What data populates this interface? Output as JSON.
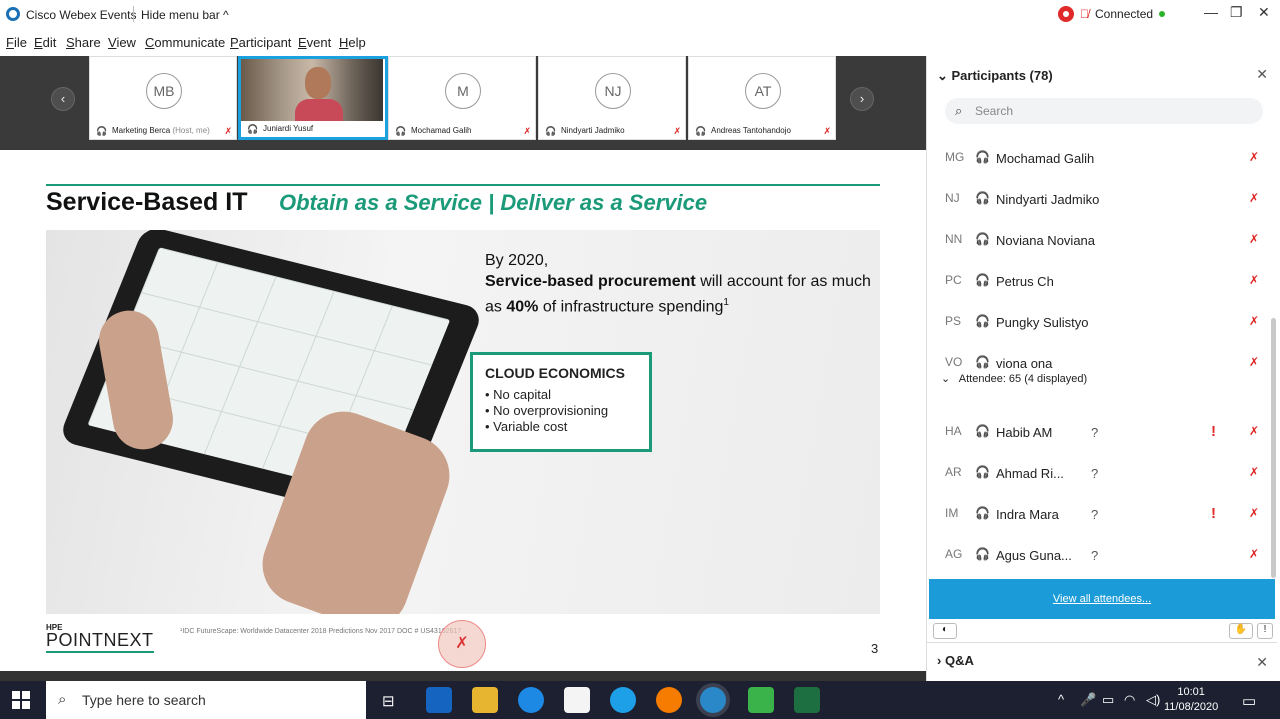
{
  "window": {
    "app_title": "Cisco Webex Events",
    "hide_menu": "Hide menu bar ^",
    "status": "Connected",
    "controls": {
      "minimize": "—",
      "restore": "❐",
      "close": "✕"
    }
  },
  "menu": [
    "File",
    "Edit",
    "Share",
    "View",
    "Communicate",
    "Participant",
    "Event",
    "Help"
  ],
  "videostrip": {
    "prev": "‹",
    "next": "›",
    "participants": [
      {
        "initials": "MB",
        "name": "Marketing Berca",
        "note": "(Host, me)"
      },
      {
        "initials": "",
        "name": "Juniardi Yusuf",
        "note": ""
      },
      {
        "initials": "M",
        "name": "Mochamad Galih",
        "note": ""
      },
      {
        "initials": "NJ",
        "name": "Nindyarti Jadmiko",
        "note": ""
      },
      {
        "initials": "AT",
        "name": "Andreas Tantohandojo",
        "note": ""
      }
    ]
  },
  "slide": {
    "title": "Service-Based IT",
    "subtitle": "Obtain as a Service  |  Deliver as a Service",
    "claim_line1": "By 2020,",
    "claim_bold": "Service-based procurement",
    "claim_rest": " will account for as much as ",
    "claim_pct": "40%",
    "claim_end": " of infrastructure spending",
    "claim_sup": "1",
    "box_title": "CLOUD ECONOMICS",
    "box_items": [
      "No capital",
      "No overprovisioning",
      "Variable cost"
    ],
    "brand_top": "HPE",
    "brand": "POINTNEXT",
    "footnote": "¹IDC FutureScape: Worldwide Datacenter 2018 Predictions Nov 2017 DOC # US43162617",
    "page": "3"
  },
  "panel": {
    "title": "Participants (78)",
    "search_placeholder": "Search",
    "panelists": [
      {
        "initials": "MG",
        "name": "Mochamad Galih"
      },
      {
        "initials": "NJ",
        "name": "Nindyarti Jadmiko"
      },
      {
        "initials": "NN",
        "name": "Noviana Noviana"
      },
      {
        "initials": "PC",
        "name": "Petrus Ch"
      },
      {
        "initials": "PS",
        "name": "Pungky Sulistyo"
      },
      {
        "initials": "VO",
        "name": "viona ona"
      }
    ],
    "attendee_header": "Attendee: 65 (4 displayed)",
    "attendees": [
      {
        "initials": "HA",
        "name": "Habib AM",
        "q": "?",
        "alert": "!"
      },
      {
        "initials": "AR",
        "name": "Ahmad Ri...",
        "q": "?",
        "alert": ""
      },
      {
        "initials": "IM",
        "name": "Indra Mara",
        "q": "?",
        "alert": "!"
      },
      {
        "initials": "AG",
        "name": "Agus Guna...",
        "q": "?",
        "alert": ""
      }
    ],
    "view_all": "View all attendees...",
    "qa_title": "Q&A"
  },
  "taskbar": {
    "search_placeholder": "Type here to search",
    "time": "10:01",
    "date": "11/08/2020"
  },
  "colors": {
    "accent": "#1a9a78",
    "webex_blue": "#1b9bd8",
    "mute_red": "#d22222"
  }
}
